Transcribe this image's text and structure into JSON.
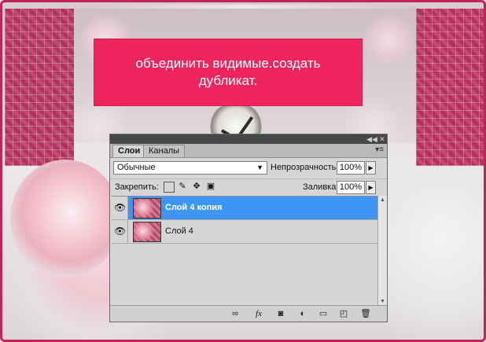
{
  "banner": {
    "line1": "объединить видимые.создать",
    "line2": "дубликат."
  },
  "panel": {
    "tabs": [
      {
        "label": "Слои",
        "active": true
      },
      {
        "label": "Каналы",
        "active": false
      }
    ],
    "blend_mode": "Обычные",
    "opacity_label": "Непрозрачность:",
    "opacity_value": "100%",
    "lock_label": "Закрепить:",
    "fill_label": "Заливка:",
    "fill_value": "100%",
    "layers": [
      {
        "name": "Слой 4 копия",
        "selected": true,
        "visible": true
      },
      {
        "name": "Слой 4",
        "selected": false,
        "visible": true
      }
    ],
    "lock_icons": [
      "lock-transparent-icon",
      "lock-paint-icon",
      "lock-move-icon",
      "lock-all-icon"
    ],
    "bottom_icons": [
      "link-icon",
      "fx-icon",
      "mask-icon",
      "adjustment-icon",
      "folder-icon",
      "new-layer-icon",
      "trash-icon"
    ]
  },
  "colors": {
    "banner": "#f0245e",
    "frame": "#c2245a",
    "selection": "#3d95f5"
  }
}
